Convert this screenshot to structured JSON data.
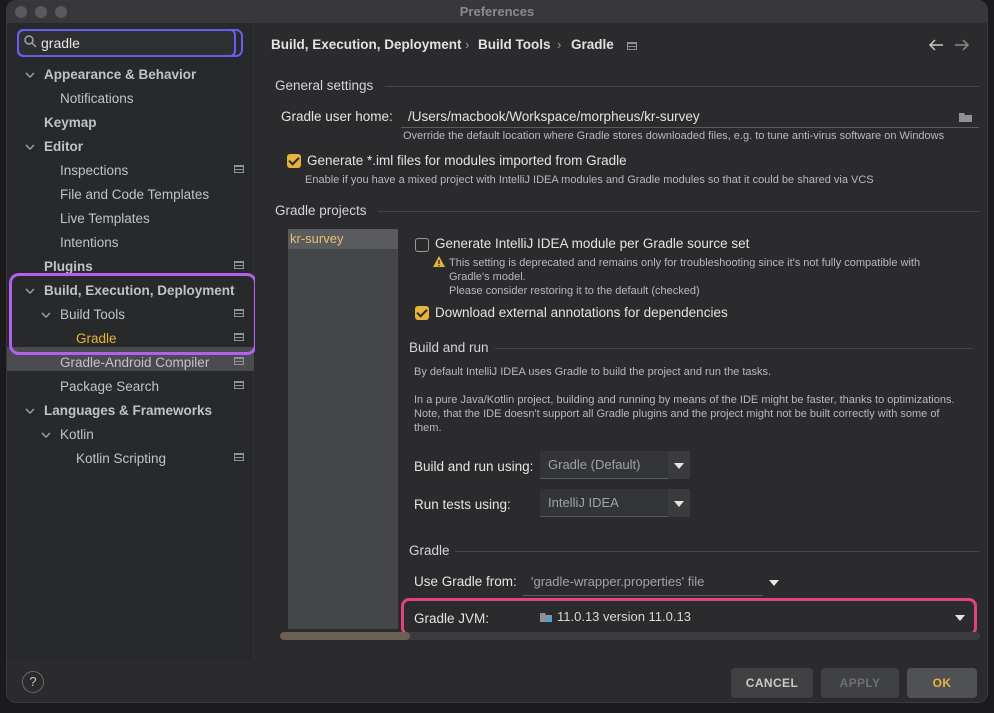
{
  "window": {
    "title": "Preferences"
  },
  "search": {
    "value": "gradle"
  },
  "tree": {
    "appearance": "Appearance & Behavior",
    "notifications": "Notifications",
    "keymap": "Keymap",
    "editor": "Editor",
    "inspections": "Inspections",
    "file_templates": "File and Code Templates",
    "live_templates": "Live Templates",
    "intentions": "Intentions",
    "plugins": "Plugins",
    "build": "Build, Execution, Deployment",
    "build_tools": "Build Tools",
    "gradle": "Gradle",
    "gradle_android": "Gradle-Android Compiler",
    "package_search": "Package Search",
    "languages": "Languages & Frameworks",
    "kotlin": "Kotlin",
    "kotlin_scripting": "Kotlin Scripting"
  },
  "breadcrumb": {
    "part1": "Build, Execution, Deployment",
    "sep": "›",
    "part2": "Build Tools",
    "part3": "Gradle"
  },
  "general": {
    "title": "General settings",
    "user_home_label": "Gradle user home:",
    "user_home_value": "/Users/macbook/Workspace/morpheus/kr-survey",
    "user_home_hint": "Override the default location where Gradle stores downloaded files, e.g. to tune anti-virus software on Windows",
    "iml_label": "Generate *.iml files for modules imported from Gradle",
    "iml_hint": "Enable if you have a mixed project with IntelliJ IDEA modules and Gradle modules so that it could be shared via VCS"
  },
  "projects": {
    "title": "Gradle projects",
    "items": [
      "kr-survey"
    ],
    "per_source_label": "Generate IntelliJ IDEA module per Gradle source set",
    "warn_line1": "This setting is deprecated and remains only for troubleshooting since it's not fully compatible with",
    "warn_line2": "Gradle's model.",
    "warn_line3": "Please consider restoring it to the default (checked)",
    "download_label": "Download external annotations for dependencies"
  },
  "build_run": {
    "title": "Build and run",
    "desc1": "By default IntelliJ IDEA uses Gradle to build the project and run the tasks.",
    "desc2": "In a pure Java/Kotlin project, building and running by means of the IDE might be faster, thanks to optimizations.",
    "desc3": "Note, that the IDE doesn't support all Gradle plugins and the project might not be built correctly with some of",
    "desc4": "them.",
    "build_label": "Build and run using:",
    "build_value": "Gradle (Default)",
    "tests_label": "Run tests using:",
    "tests_value": "IntelliJ IDEA"
  },
  "gradle_section": {
    "title": "Gradle",
    "use_from_label": "Use Gradle from:",
    "use_from_value": "'gradle-wrapper.properties' file",
    "jvm_label": "Gradle JVM:",
    "jvm_value": "11.0.13 version 11.0.13"
  },
  "footer": {
    "help": "?",
    "cancel": "CANCEL",
    "apply": "APPLY",
    "ok": "OK"
  },
  "colors": {
    "accent": "#e6b43c",
    "search_highlight": "#6a5cf0",
    "tree_highlight": "#b55ff0",
    "jvm_highlight": "#e0447a"
  }
}
